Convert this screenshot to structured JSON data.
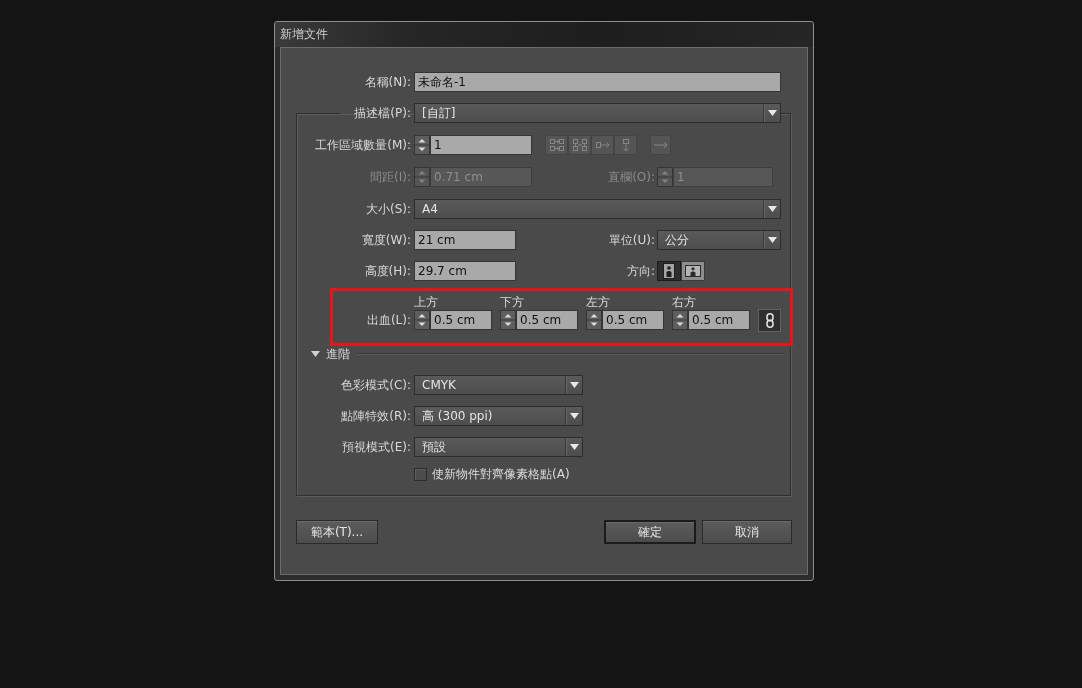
{
  "window": {
    "title": "新增文件"
  },
  "name": {
    "label": "名稱(N):",
    "value": "未命名-1"
  },
  "profile": {
    "label": "描述檔(P):",
    "value": "[自訂]"
  },
  "artboards": {
    "label": "工作區域數量(M):",
    "value": "1",
    "layout_buttons": [
      {
        "kind": "grid-by-row",
        "disabled": true
      },
      {
        "kind": "grid-by-column",
        "disabled": true
      },
      {
        "kind": "row",
        "disabled": true
      },
      {
        "kind": "column",
        "disabled": true
      },
      {
        "kind": "direction",
        "disabled": true
      }
    ]
  },
  "spacing": {
    "label": "間距(I):",
    "value": "0.71 cm",
    "disabled": true
  },
  "columns": {
    "label": "直欄(O):",
    "value": "1",
    "disabled": true
  },
  "size": {
    "label": "大小(S):",
    "value": "A4"
  },
  "width": {
    "label": "寬度(W):",
    "value": "21 cm"
  },
  "units": {
    "label": "單位(U):",
    "value": "公分"
  },
  "height": {
    "label": "高度(H):",
    "value": "29.7 cm"
  },
  "orientation": {
    "label": "方向:",
    "options": [
      {
        "kind": "portrait",
        "selected": true
      },
      {
        "kind": "landscape",
        "selected": false
      }
    ]
  },
  "bleed": {
    "label": "出血(L):",
    "highlighted": true,
    "linked": true,
    "sides": [
      {
        "label": "上方",
        "value": "0.5 cm"
      },
      {
        "label": "下方",
        "value": "0.5 cm"
      },
      {
        "label": "左方",
        "value": "0.5 cm"
      },
      {
        "label": "右方",
        "value": "0.5 cm"
      }
    ]
  },
  "advanced": {
    "label": "進階",
    "expanded": true,
    "fields": [
      {
        "label": "色彩模式(C):",
        "value": "CMYK"
      },
      {
        "label": "點陣特效(R):",
        "value": "高 (300 ppi)"
      },
      {
        "label": "預視模式(E):",
        "value": "預設"
      }
    ],
    "checkbox": {
      "label": "使新物件對齊像素格點(A)",
      "checked": false
    }
  },
  "buttons": [
    {
      "kind": "template",
      "label": "範本(T)...",
      "default": false
    },
    {
      "kind": "confirm",
      "label": "確定",
      "default": true
    },
    {
      "kind": "cancel",
      "label": "取消",
      "default": false
    }
  ]
}
